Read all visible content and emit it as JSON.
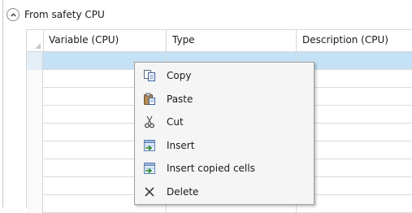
{
  "section": {
    "title": "From safety CPU"
  },
  "grid": {
    "columns": [
      "Variable (CPU)",
      "Type",
      "Description (CPU)"
    ]
  },
  "context_menu": {
    "items": [
      {
        "label": "Copy",
        "icon": "copy-icon"
      },
      {
        "label": "Paste",
        "icon": "paste-icon"
      },
      {
        "label": "Cut",
        "icon": "cut-icon"
      },
      {
        "label": "Insert",
        "icon": "insert-icon"
      },
      {
        "label": "Insert copied cells",
        "icon": "insert-copied-cells-icon"
      },
      {
        "label": "Delete",
        "icon": "delete-icon"
      }
    ]
  }
}
